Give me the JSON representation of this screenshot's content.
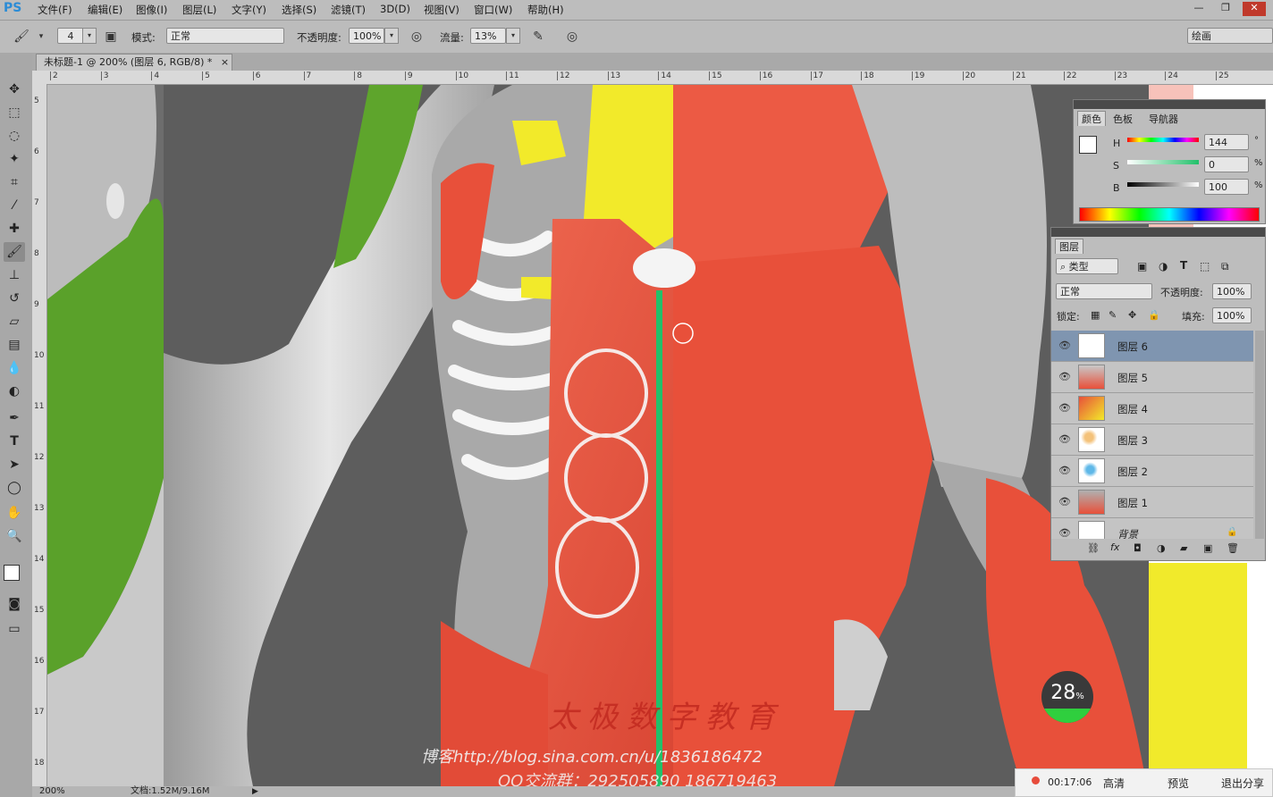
{
  "app": {
    "logo": "PS"
  },
  "menu": [
    "文件(F)",
    "编辑(E)",
    "图像(I)",
    "图层(L)",
    "文字(Y)",
    "选择(S)",
    "滤镜(T)",
    "3D(D)",
    "视图(V)",
    "窗口(W)",
    "帮助(H)"
  ],
  "window_controls": [
    "—",
    "❐",
    "✕"
  ],
  "options": {
    "brush_size": "4",
    "mode_label": "模式:",
    "mode_value": "正常",
    "opacity_label": "不透明度:",
    "opacity_value": "100%",
    "flow_label": "流量:",
    "flow_value": "13%",
    "workspace": "绘画"
  },
  "document_tab": {
    "title": "未标题-1 @ 200% (图层 6, RGB/8) *",
    "close": "×"
  },
  "ruler": {
    "h_ticks": [
      "2",
      "3",
      "4",
      "5",
      "6",
      "7",
      "8",
      "9",
      "10",
      "11",
      "12",
      "13",
      "14",
      "15",
      "16",
      "17",
      "18",
      "19",
      "20",
      "21",
      "22",
      "23",
      "24",
      "25"
    ],
    "v_ticks": [
      "5",
      "6",
      "7",
      "8",
      "9",
      "10",
      "11",
      "12",
      "13",
      "14",
      "15",
      "16",
      "17",
      "18"
    ]
  },
  "color_panel": {
    "tabs": [
      "颜色",
      "色板",
      "导航器"
    ],
    "h_label": "H",
    "h_value": "144",
    "h_unit": "°",
    "s_label": "S",
    "s_value": "0",
    "s_unit": "%",
    "b_label": "B",
    "b_value": "100",
    "b_unit": "%"
  },
  "layers_panel": {
    "title": "图层",
    "filter_label": "类型",
    "blend_mode": "正常",
    "opacity_label": "不透明度:",
    "opacity_value": "100%",
    "lock_label": "锁定:",
    "fill_label": "填充:",
    "fill_value": "100%",
    "layers": [
      {
        "name": "图层 6",
        "selected": true
      },
      {
        "name": "图层 5",
        "selected": false
      },
      {
        "name": "图层 4",
        "selected": false
      },
      {
        "name": "图层 3",
        "selected": false
      },
      {
        "name": "图层 2",
        "selected": false
      },
      {
        "name": "图层 1",
        "selected": false
      },
      {
        "name": "背景",
        "selected": false
      }
    ]
  },
  "status": {
    "zoom": "200%",
    "doc_info": "文档:1.52M/9.16M"
  },
  "progress_badge": {
    "value": "28",
    "unit": "%"
  },
  "watermark": {
    "blog": "博客http://blog.sina.com.cn/u/1836186472",
    "qq": "QQ交流群：292505890 186719463",
    "logo_text": "太极数字教育"
  },
  "recording": {
    "time": "00:17:06",
    "quality": "高清",
    "preview": "预览",
    "exit": "退出分享"
  },
  "colors": {
    "accent": "#2b8cd6",
    "muscle": "#e8503a",
    "bone": "#f2ea2a",
    "selected_layer": "#7f95b0",
    "guide": "#22c06a"
  }
}
